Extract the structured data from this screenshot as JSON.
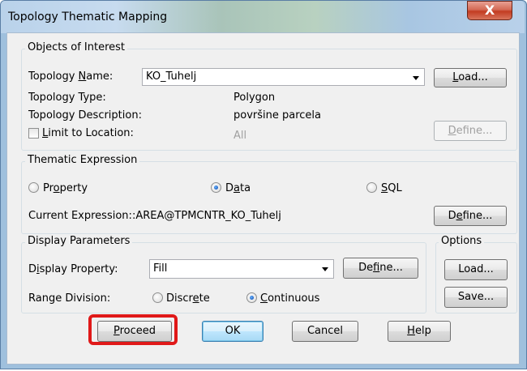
{
  "window": {
    "title": "Topology Thematic Mapping",
    "close_glyph": "X"
  },
  "objects_of_interest": {
    "group_label": "Objects of Interest",
    "topology_name_label": "Topology Name:",
    "topology_name_value": "KO_Tuhelj",
    "load_label": "Load...",
    "topology_type_label": "Topology Type:",
    "topology_type_value": "Polygon",
    "topology_description_label": "Topology Description:",
    "topology_description_value": "površine parcela",
    "limit_to_location_label": "Limit to Location:",
    "limit_to_location_checked": false,
    "location_value": "All",
    "define_label": "Define..."
  },
  "thematic_expression": {
    "group_label": "Thematic Expression",
    "options": [
      "Property",
      "Data",
      "SQL"
    ],
    "selected": "Data",
    "current_expression_label": "Current Expression:",
    "current_expression_value": ":AREA@TPMCNTR_KO_Tuhelj",
    "define_label": "Define..."
  },
  "display_parameters": {
    "group_label": "Display Parameters",
    "display_property_label": "Display Property:",
    "display_property_value": "Fill",
    "define_label": "Define...",
    "range_division_label": "Range Division:",
    "range_options": [
      "Discrete",
      "Continuous"
    ],
    "range_selected": "Continuous"
  },
  "options": {
    "group_label": "Options",
    "load_label": "Load...",
    "save_label": "Save..."
  },
  "footer": {
    "proceed_label": "Proceed",
    "ok_label": "OK",
    "cancel_label": "Cancel",
    "help_label": "Help"
  },
  "annotation": {
    "highlight_color": "#e01919"
  }
}
